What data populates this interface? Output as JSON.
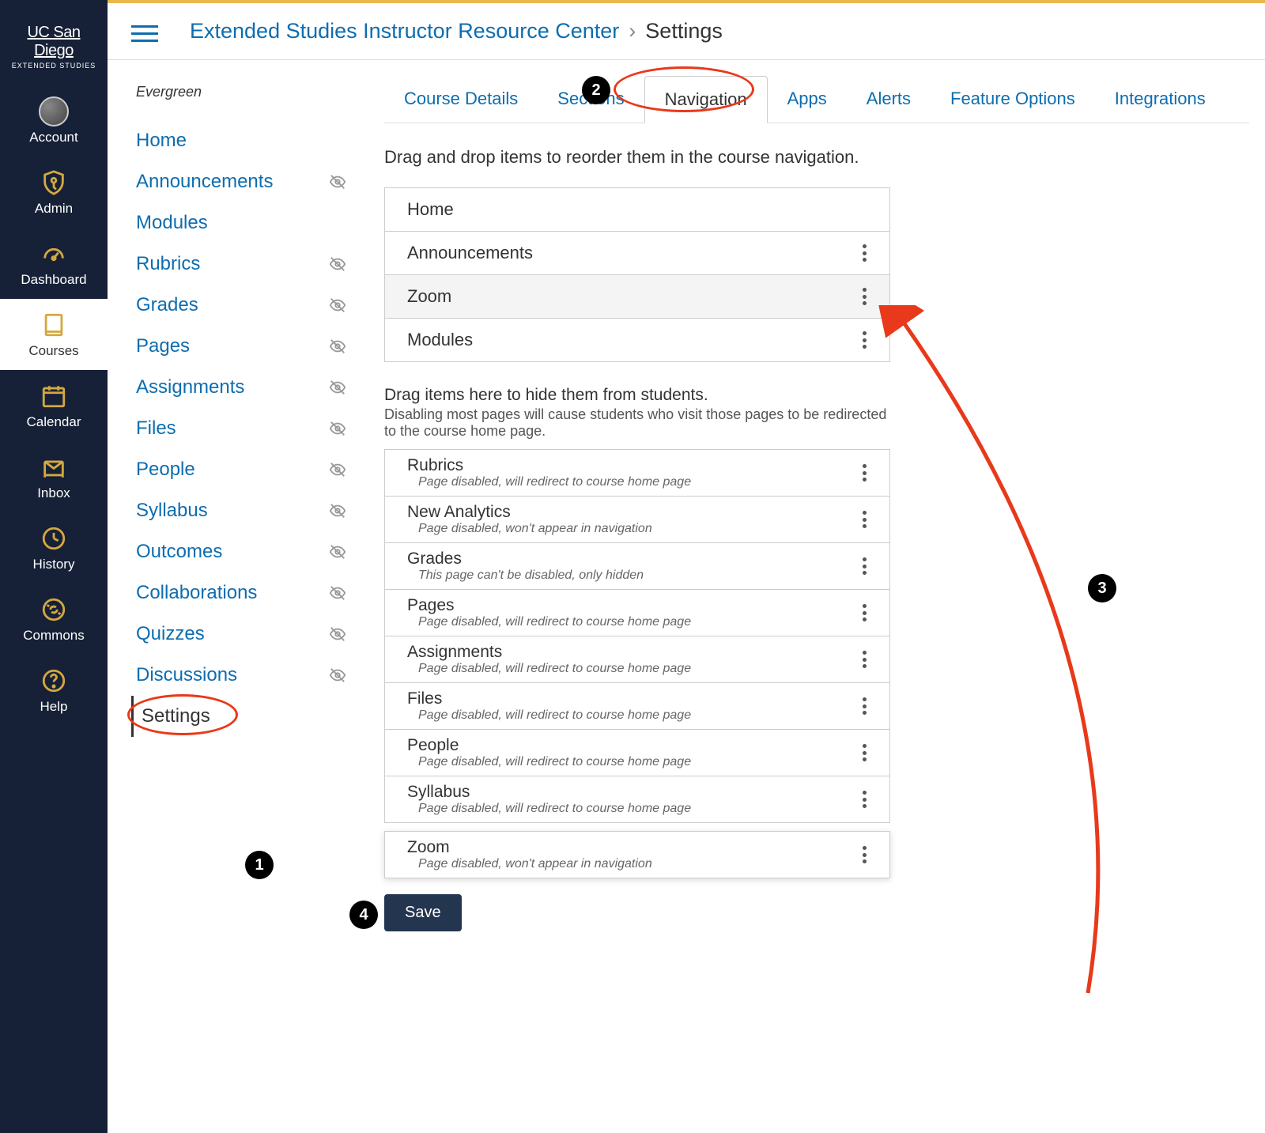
{
  "logo": {
    "main": "UC San Diego",
    "sub": "EXTENDED STUDIES"
  },
  "globalNav": [
    {
      "label": "Account",
      "icon": "avatar"
    },
    {
      "label": "Admin",
      "icon": "shield-key"
    },
    {
      "label": "Dashboard",
      "icon": "speedometer"
    },
    {
      "label": "Courses",
      "icon": "book",
      "active": true
    },
    {
      "label": "Calendar",
      "icon": "calendar"
    },
    {
      "label": "Inbox",
      "icon": "inbox"
    },
    {
      "label": "History",
      "icon": "clock"
    },
    {
      "label": "Commons",
      "icon": "commons"
    },
    {
      "label": "Help",
      "icon": "help"
    }
  ],
  "breadcrumb": {
    "link": "Extended Studies Instructor Resource Center",
    "current": "Settings"
  },
  "courseBadge": "Evergreen",
  "courseNav": [
    {
      "label": "Home",
      "hidden": false
    },
    {
      "label": "Announcements",
      "hidden": true
    },
    {
      "label": "Modules",
      "hidden": false
    },
    {
      "label": "Rubrics",
      "hidden": true
    },
    {
      "label": "Grades",
      "hidden": true
    },
    {
      "label": "Pages",
      "hidden": true
    },
    {
      "label": "Assignments",
      "hidden": true
    },
    {
      "label": "Files",
      "hidden": true
    },
    {
      "label": "People",
      "hidden": true
    },
    {
      "label": "Syllabus",
      "hidden": true
    },
    {
      "label": "Outcomes",
      "hidden": true
    },
    {
      "label": "Collaborations",
      "hidden": true
    },
    {
      "label": "Quizzes",
      "hidden": true
    },
    {
      "label": "Discussions",
      "hidden": true
    },
    {
      "label": "Settings",
      "hidden": false,
      "active": true
    }
  ],
  "tabs": [
    "Course Details",
    "Sections",
    "Navigation",
    "Apps",
    "Alerts",
    "Feature Options",
    "Integrations"
  ],
  "selectedTab": "Navigation",
  "instructions": "Drag and drop items to reorder them in the course navigation.",
  "visibleItems": [
    {
      "name": "Home",
      "kebab": false
    },
    {
      "name": "Announcements",
      "kebab": true
    },
    {
      "name": "Zoom",
      "kebab": true,
      "highlighted": true
    },
    {
      "name": "Modules",
      "kebab": true
    }
  ],
  "hideHeading": "Drag items here to hide them from students.",
  "hideSubtext": "Disabling most pages will cause students who visit those pages to be redirected to the course home page.",
  "hiddenItems": [
    {
      "name": "Rubrics",
      "desc": "Page disabled, will redirect to course home page"
    },
    {
      "name": "New Analytics",
      "desc": "Page disabled, won't appear in navigation"
    },
    {
      "name": "Grades",
      "desc": "This page can't be disabled, only hidden"
    },
    {
      "name": "Pages",
      "desc": "Page disabled, will redirect to course home page"
    },
    {
      "name": "Assignments",
      "desc": "Page disabled, will redirect to course home page"
    },
    {
      "name": "Files",
      "desc": "Page disabled, will redirect to course home page"
    },
    {
      "name": "People",
      "desc": "Page disabled, will redirect to course home page"
    },
    {
      "name": "Syllabus",
      "desc": "Page disabled, will redirect to course home page"
    }
  ],
  "draggingItem": {
    "name": "Zoom",
    "desc": "Page disabled, won't appear in navigation"
  },
  "saveLabel": "Save",
  "annotations": {
    "b1": "1",
    "b2": "2",
    "b3": "3",
    "b4": "4"
  }
}
